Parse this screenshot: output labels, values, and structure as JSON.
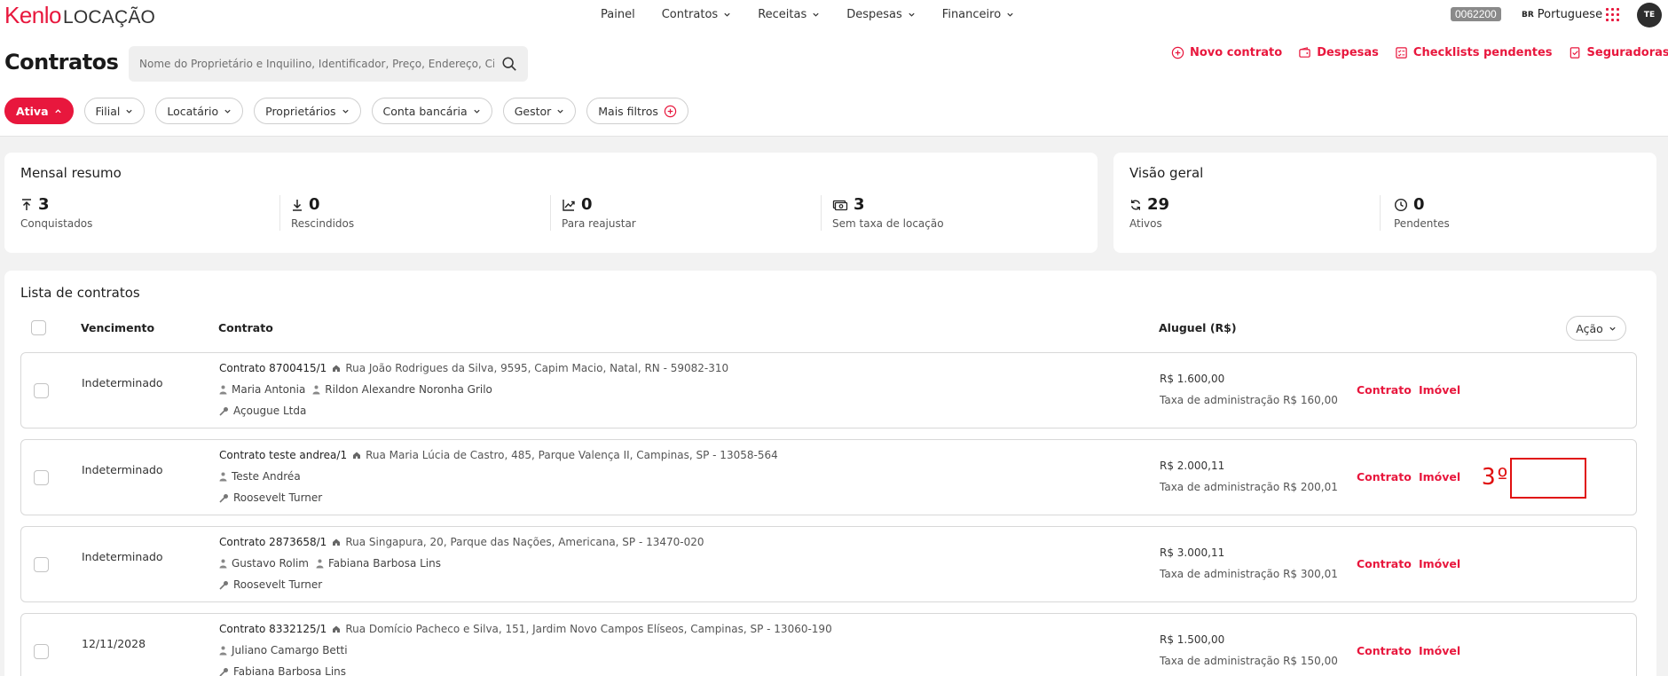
{
  "brand": {
    "logo_primary": "Kenlo",
    "logo_secondary": "LOCAÇÃO",
    "accent": "#e8173d"
  },
  "nav": {
    "items": [
      "Painel",
      "Contratos",
      "Receitas",
      "Despesas",
      "Financeiro"
    ]
  },
  "topbar": {
    "account": "0062200",
    "flag": "BR",
    "language": "Portuguese",
    "avatar": "TE"
  },
  "header": {
    "title": "Contratos",
    "search_placeholder": "Nome do Proprietário e Inquilino, Identificador, Preço, Endereço, Cida",
    "actions": [
      "Novo contrato",
      "Despesas",
      "Checklists pendentes",
      "Seguradoras"
    ]
  },
  "filters": [
    "Ativa",
    "Filial",
    "Locatário",
    "Proprietários",
    "Conta bancária",
    "Gestor",
    "Mais filtros"
  ],
  "summary": {
    "title": "Mensal resumo",
    "stats": [
      {
        "value": "3",
        "label": "Conquistados",
        "icon": "upload-arrow-icon"
      },
      {
        "value": "0",
        "label": "Rescindidos",
        "icon": "download-arrow-icon"
      },
      {
        "value": "0",
        "label": "Para reajustar",
        "icon": "trend-chart-icon"
      },
      {
        "value": "3",
        "label": "Sem taxa de locação",
        "icon": "cash-icon"
      }
    ]
  },
  "overview": {
    "title": "Visão geral",
    "stats": [
      {
        "value": "29",
        "label": "Ativos",
        "icon": "refresh-icon"
      },
      {
        "value": "0",
        "label": "Pendentes",
        "icon": "clock-icon"
      }
    ]
  },
  "list": {
    "title": "Lista de contratos",
    "columns": {
      "venc": "Vencimento",
      "contrato": "Contrato",
      "aluguel": "Aluguel (R$)"
    },
    "acao": "Ação",
    "link_contrato": "Contrato",
    "link_imovel": "Imóvel",
    "rows": [
      {
        "venc": "Indeterminado",
        "name": "Contrato 8700415/1",
        "address": "Rua João Rodrigues da Silva, 9595, Capim Macio, Natal, RN - 59082-310",
        "people": [
          "Maria Antonia",
          "Rildon Alexandre Noronha Grilo"
        ],
        "owner": "Açougue Ltda",
        "amount": "R$ 1.600,00",
        "fee": "Taxa de administração R$ 160,00"
      },
      {
        "venc": "Indeterminado",
        "name": "Contrato teste andrea/1",
        "address": "Rua Maria Lúcia de Castro, 485, Parque Valença II, Campinas, SP - 13058-564",
        "people": [
          "Teste Andréa"
        ],
        "owner": "Roosevelt Turner",
        "amount": "R$ 2.000,11",
        "fee": "Taxa de administração R$ 200,01"
      },
      {
        "venc": "Indeterminado",
        "name": "Contrato 2873658/1",
        "address": "Rua Singapura, 20, Parque das Nações, Americana, SP - 13470-020",
        "people": [
          "Gustavo Rolim",
          "Fabiana Barbosa Lins"
        ],
        "owner": "Roosevelt Turner",
        "amount": "R$ 3.000,11",
        "fee": "Taxa de administração R$ 300,01"
      },
      {
        "venc": "12/11/2028",
        "name": "Contrato 8332125/1",
        "address": "Rua Domício Pacheco e Silva, 151, Jardim Novo Campos Elíseos, Campinas, SP - 13060-190",
        "people": [
          "Juliano Camargo Betti"
        ],
        "owner": "Fabiana Barbosa Lins",
        "amount": "R$ 1.500,00",
        "fee": "Taxa de administração R$ 150,00"
      }
    ]
  },
  "annotation": {
    "step": "3º"
  }
}
